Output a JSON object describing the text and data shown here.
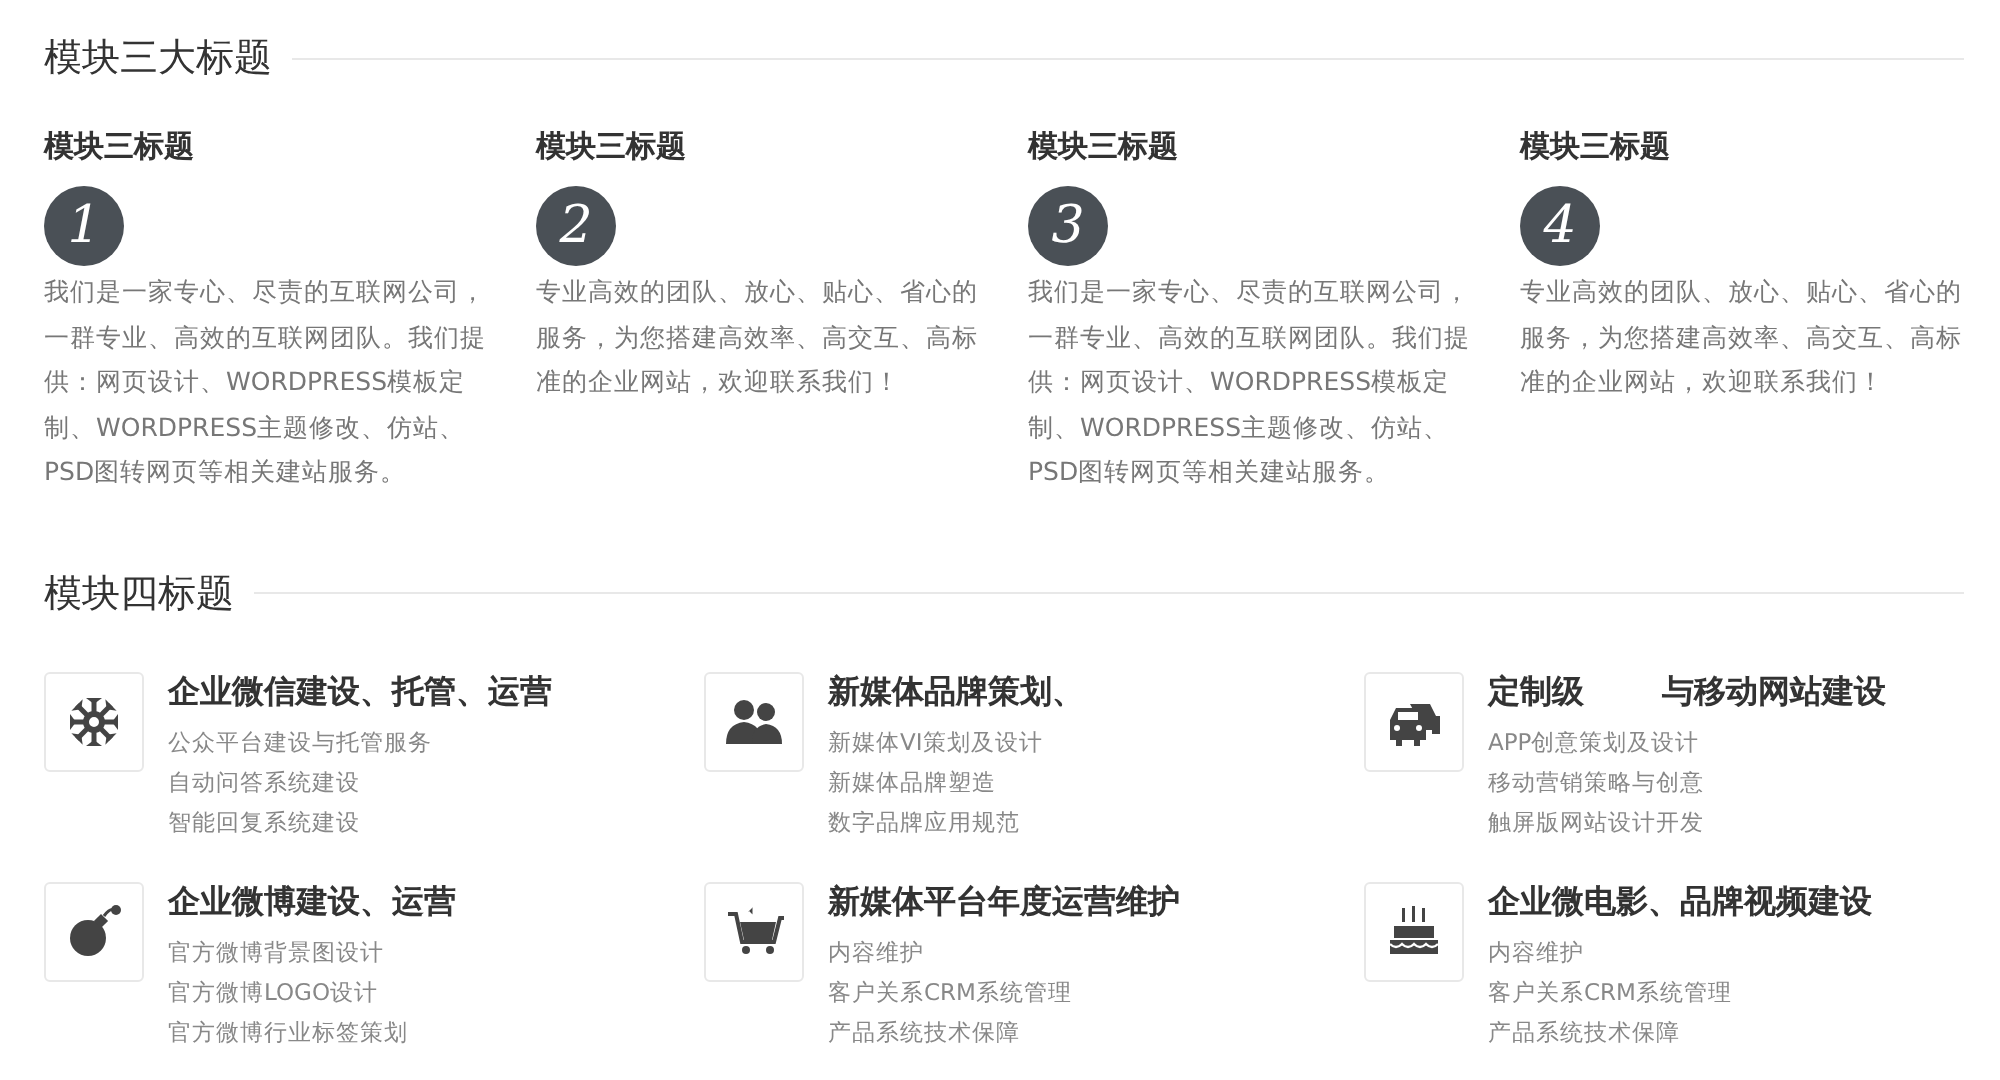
{
  "module3": {
    "title": "模块三大标题",
    "items": [
      {
        "heading": "模块三标题",
        "number": "1",
        "text": "我们是一家专心、尽责的互联网公司，一群专业、高效的互联网团队。我们提供：网页设计、WORDPRESS模板定制、WORDPRESS主题修改、仿站、PSD图转网页等相关建站服务。"
      },
      {
        "heading": "模块三标题",
        "number": "2",
        "text": "专业高效的团队、放心、贴心、省心的服务，为您搭建高效率、高交互、高标准的企业网站，欢迎联系我们！"
      },
      {
        "heading": "模块三标题",
        "number": "3",
        "text": "我们是一家专心、尽责的互联网公司，一群专业、高效的互联网团队。我们提供：网页设计、WORDPRESS模板定制、WORDPRESS主题修改、仿站、PSD图转网页等相关建站服务。"
      },
      {
        "heading": "模块三标题",
        "number": "4",
        "text": "专业高效的团队、放心、贴心、省心的服务，为您搭建高效率、高交互、高标准的企业网站，欢迎联系我们！"
      }
    ]
  },
  "module4": {
    "title": "模块四标题",
    "services": [
      {
        "title": "企业微信建设、托管、运营",
        "lines": [
          "公众平台建设与托管服务",
          "自动问答系统建设",
          "智能回复系统建设"
        ]
      },
      {
        "title": "新媒体品牌策划、",
        "lines": [
          "新媒体VI策划及设计",
          "新媒体品牌塑造",
          "数字品牌应用规范"
        ]
      },
      {
        "title": "定制级       与移动网站建设",
        "lines": [
          "APP创意策划及设计",
          "移动营销策略与创意",
          "触屏版网站设计开发"
        ]
      },
      {
        "title": "企业微博建设、运营",
        "lines": [
          "官方微博背景图设计",
          "官方微博LOGO设计",
          "官方微博行业标签策划"
        ]
      },
      {
        "title": "新媒体平台年度运营维护",
        "lines": [
          "内容维护",
          "客户关系CRM系统管理",
          "产品系统技术保障"
        ]
      },
      {
        "title": "企业微电影、品牌视频建设",
        "lines": [
          "内容维护",
          "客户关系CRM系统管理",
          "产品系统技术保障"
        ]
      }
    ]
  }
}
